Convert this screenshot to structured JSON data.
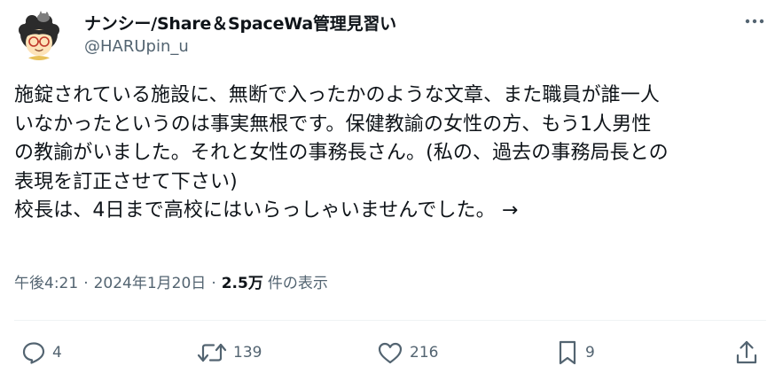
{
  "user": {
    "display_name": "ナンシー/Share＆SpaceWa管理見習い",
    "handle": "@HARUpin_u"
  },
  "tweet": {
    "text": "施錠されている施設に、無断で入ったかのような文章、また職員が誰一人\nいなかったというのは事実無根です。保健教諭の女性の方、もう1人男性\nの教諭がいました。それと女性の事務長さん。(私の、過去の事務局長との\n表現を訂正させて下さい)\n校長は、4日まで高校にはいらっしゃいませんでした。 →"
  },
  "meta": {
    "time": "午後4:21",
    "date": "2024年1月20日",
    "separator": "·",
    "views_count": "2.5万",
    "views_label": "件の表示"
  },
  "actions": {
    "reply": {
      "icon": "reply-icon",
      "count": "4"
    },
    "repost": {
      "icon": "repost-icon",
      "count": "139"
    },
    "like": {
      "icon": "heart-icon",
      "count": "216"
    },
    "bookmark": {
      "icon": "bookmark-icon",
      "count": "9"
    },
    "share": {
      "icon": "share-icon"
    }
  },
  "colors": {
    "text": "#0f1419",
    "secondary": "#536471",
    "divider": "#eff3f4",
    "background": "#ffffff"
  }
}
